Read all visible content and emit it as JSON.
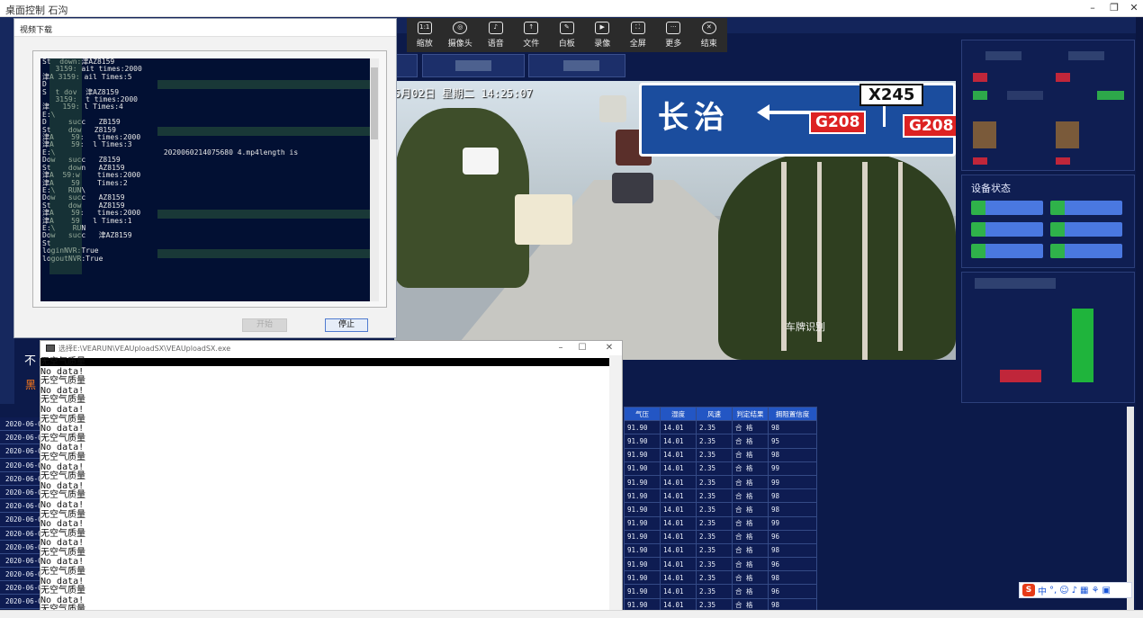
{
  "outer_window": {
    "title": "桌面控制 石沟",
    "minimize": "–",
    "restore": "❐",
    "close": "✕"
  },
  "toolbar": [
    {
      "label": "缩放",
      "glyph": "1:1",
      "icon": "zoom-icon"
    },
    {
      "label": "摄像头",
      "glyph": "◎",
      "icon": "camera-icon"
    },
    {
      "label": "语音",
      "glyph": "♪",
      "icon": "mic-icon"
    },
    {
      "label": "文件",
      "glyph": "↑",
      "icon": "file-icon"
    },
    {
      "label": "白板",
      "glyph": "✎",
      "icon": "whiteboard-icon"
    },
    {
      "label": "录像",
      "glyph": "▶",
      "icon": "record-icon"
    },
    {
      "label": "全屏",
      "glyph": "⛶",
      "icon": "fullscreen-icon"
    },
    {
      "label": "更多",
      "glyph": "···",
      "icon": "more-icon"
    },
    {
      "label": "结束",
      "glyph": "✕",
      "icon": "end-icon"
    }
  ],
  "video": {
    "osd": "5月02日 星期二 14:25:07",
    "sign_city": "长治",
    "sign_route_x": "X245",
    "sign_route_g1": "G208",
    "sign_route_g2": "G208",
    "watermark": "车牌识别"
  },
  "right_panel": {
    "device_status_title": "设备状态"
  },
  "download_dialog": {
    "title": "视频下载",
    "console_lines": [
      "St  down:津AZ8159",
      "   3159: ait times:2000",
      "津A 3159: ail Times:5",
      "D",
      "S  t dov  津AZ8159",
      "   3159:  t times:2000",
      "津   159: l Times:4",
      "E:\\",
      "D     succ   ZB159",
      "St    dow   Z8159",
      "津A    59:   times:2000",
      "津A    59:  l Times:3",
      "E:\\                         2020060214075680 4.mp4length is",
      "Dow   succ   Z8159",
      "St    down   AZ8159",
      "津A  59:w    times:2000",
      "津A    59    Times:2",
      "E:\\   RUN\\",
      "Dow   succ   AZ8159",
      "St    dow    AZ8159",
      "津A    59:   times:2000",
      "津A    59   l Times:1",
      "E:\\    RUN",
      "Dow   succ   津AZ8159",
      "St",
      "",
      "loginNVR:True",
      "logoutNVR:True"
    ],
    "download_button": "开始",
    "stop_button": "停止"
  },
  "cmd_window": {
    "title": "选择E:\\VEARUN\\VEAUploadSX\\VEAUploadSX.exe",
    "lines": [
      "无空气质量",
      "No data!",
      "无空气质量",
      "No data!",
      "无空气质量",
      "No data!",
      "无空气质量",
      "No data!",
      "无空气质量",
      "No data!",
      "无空气质量",
      "No data!",
      "无空气质量",
      "No data!",
      "无空气质量",
      "No data!",
      "无空气质量",
      "No data!",
      "无空气质量",
      "No data!",
      "无空气质量",
      "No data!",
      "无空气质量",
      "No data!",
      "无空气质量",
      "No data!",
      "无空气质量"
    ]
  },
  "side_labels": {
    "white": "不",
    "orange": "黑"
  },
  "table": {
    "headers": [
      "气压",
      "湿度",
      "风速",
      "判定结果",
      "拥阻置信度"
    ],
    "dates": [
      "2020-06-0",
      "2020-06-0",
      "2020-06-0",
      "2020-06-0",
      "2020-06-0",
      "2020-06-0",
      "2020-06-0",
      "2020-06-0",
      "2020-06-0",
      "2020-06-0",
      "2020-06-0",
      "2020-06-0",
      "2020-06-0",
      "2020-06-0"
    ],
    "rows": [
      [
        "91.90",
        "14.01",
        "2.35",
        "合 格",
        "98"
      ],
      [
        "91.90",
        "14.01",
        "2.35",
        "合 格",
        "95"
      ],
      [
        "91.90",
        "14.01",
        "2.35",
        "合 格",
        "98"
      ],
      [
        "91.90",
        "14.01",
        "2.35",
        "合 格",
        "99"
      ],
      [
        "91.90",
        "14.01",
        "2.35",
        "合 格",
        "99"
      ],
      [
        "91.90",
        "14.01",
        "2.35",
        "合 格",
        "98"
      ],
      [
        "91.90",
        "14.01",
        "2.35",
        "合 格",
        "98"
      ],
      [
        "91.90",
        "14.01",
        "2.35",
        "合 格",
        "99"
      ],
      [
        "91.90",
        "14.01",
        "2.35",
        "合 格",
        "96"
      ],
      [
        "91.90",
        "14.01",
        "2.35",
        "合 格",
        "98"
      ],
      [
        "91.90",
        "14.01",
        "2.35",
        "合 格",
        "96"
      ],
      [
        "91.90",
        "14.01",
        "2.35",
        "合 格",
        "98"
      ],
      [
        "91.90",
        "14.01",
        "2.35",
        "合 格",
        "96"
      ],
      [
        "91.90",
        "14.01",
        "2.35",
        "合 格",
        "98"
      ]
    ]
  },
  "ime": {
    "logo": "S",
    "mode": "中"
  },
  "colors": {
    "accent": "#2356c4",
    "desk_bg": "#0c1a4a",
    "console_bg": "#021033"
  }
}
